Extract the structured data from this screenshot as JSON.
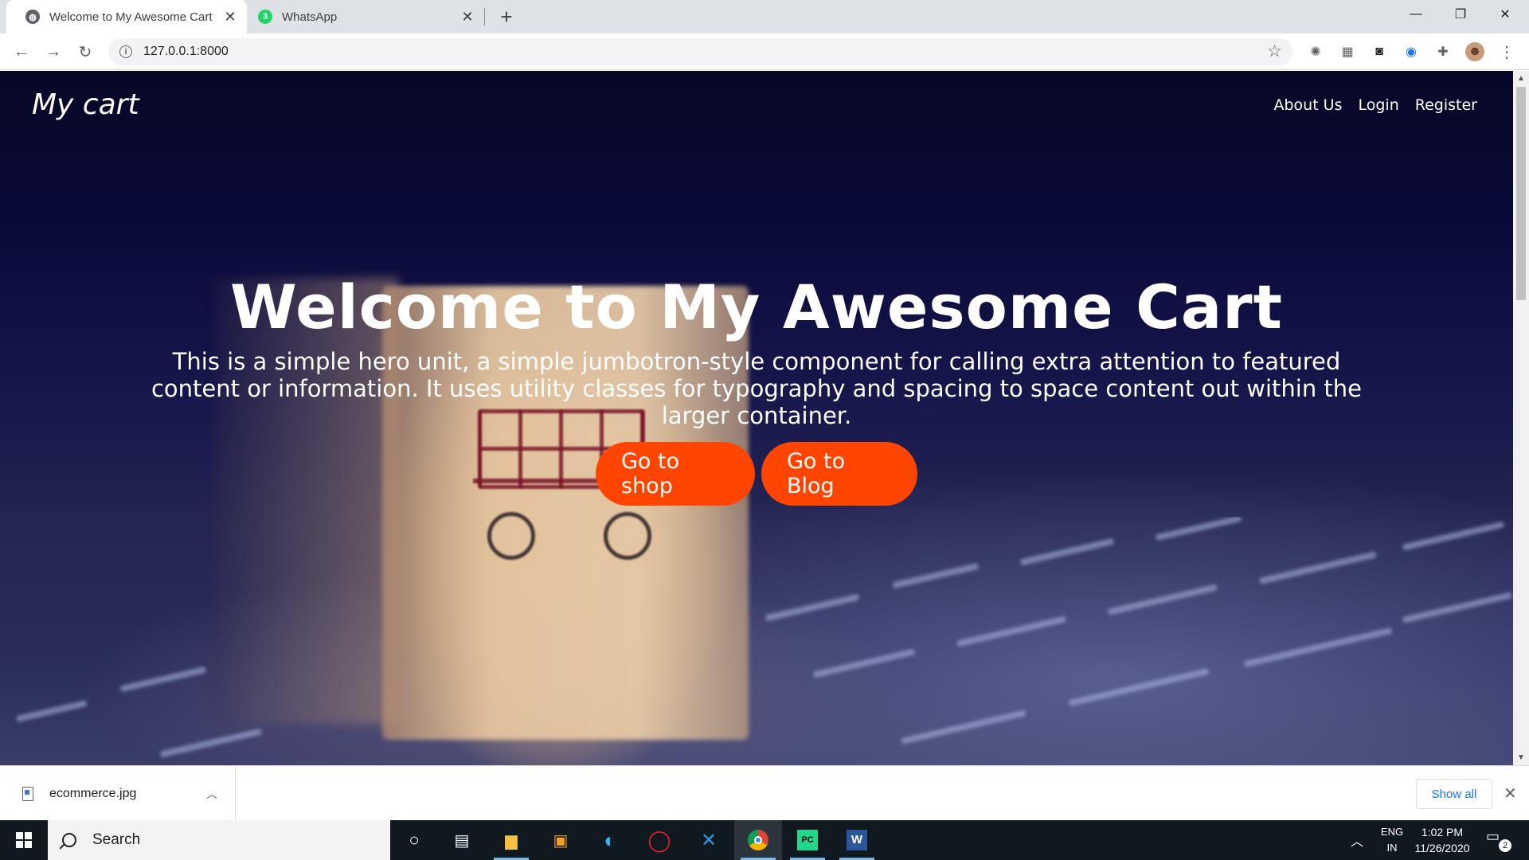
{
  "browser": {
    "tabs": [
      {
        "title": "Welcome to My Awesome Cart",
        "icon": "globe-icon",
        "active": true
      },
      {
        "title": "WhatsApp",
        "icon": "whatsapp-icon",
        "badge": "3",
        "active": false
      }
    ],
    "url": "127.0.0.1:8000",
    "extensions": [
      "extension-1-icon",
      "extension-2-icon",
      "camera-icon",
      "extension-3-icon",
      "puzzle-icon",
      "profile-avatar"
    ]
  },
  "page": {
    "brand": "My cart",
    "nav": [
      "About Us",
      "Login",
      "Register"
    ],
    "hero_title": "Welcome to My Awesome Cart",
    "hero_text": "This is a simple hero unit, a simple jumbotron-style component for calling extra attention to featured content or information. It uses utility classes for typography and spacing to space content out within the larger container.",
    "buttons": [
      "Go to shop",
      "Go to Blog"
    ],
    "button_color": "#ff4500"
  },
  "downloads": {
    "file_name": "ecommerce.jpg",
    "show_all": "Show all"
  },
  "taskbar": {
    "search_placeholder": "Search",
    "language": "ENG",
    "region": "IN",
    "time": "1:02 PM",
    "date": "11/26/2020",
    "notification_count": "2"
  }
}
